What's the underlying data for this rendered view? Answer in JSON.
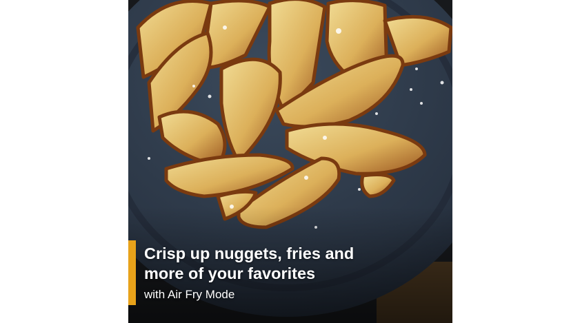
{
  "colors": {
    "background": "#ffffff",
    "plate": "#2d3a4a",
    "accent_bar": "#e8a21a",
    "caption_text": "#ffffff"
  },
  "photo": {
    "subject": "roasted-potato-wedges-on-blue-plate"
  },
  "caption": {
    "headline_line1": "Crisp up nuggets, fries and",
    "headline_line2": "more of your favorites",
    "subline": "with Air Fry Mode"
  }
}
